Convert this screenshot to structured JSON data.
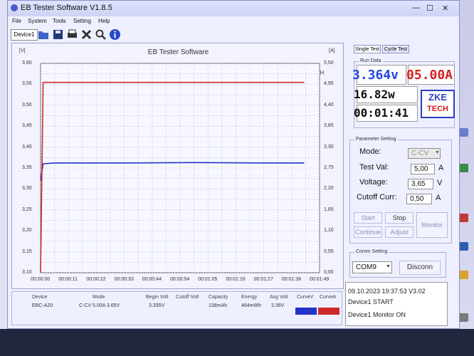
{
  "window": {
    "title": "EB Tester Software V1.8.5"
  },
  "menu": [
    "File",
    "System",
    "Tools",
    "Setting",
    "Help"
  ],
  "toolbar": {
    "device_tab": "Device1",
    "icons": [
      "folder-open-icon",
      "save-icon",
      "print-icon",
      "tools-icon",
      "magnifier-icon",
      "info-icon"
    ]
  },
  "chart": {
    "title": "EB Tester Software",
    "watermark": "ZKETECH",
    "left_unit": "[V]",
    "right_unit": "[A]",
    "y_ticks_left": [
      "3,60",
      "3,55",
      "3,50",
      "3,45",
      "3,40",
      "3,35",
      "3,30",
      "3,25",
      "3,20",
      "3,15",
      "3,10"
    ],
    "y_ticks_right": [
      "5,50",
      "4,95",
      "4,40",
      "3,85",
      "3,30",
      "2,75",
      "2,20",
      "1,65",
      "1,10",
      "0,55",
      "0,00"
    ],
    "x_ticks": [
      "00:00:00",
      "00:00:11",
      "00:00:22",
      "00:00:33",
      "00:00:44",
      "00:00:54",
      "00:01:05",
      "00:01:16",
      "00:01:27",
      "00:01:38",
      "00:01:49"
    ],
    "colors": {
      "voltage": "#2432c8",
      "current": "#cc2a2a"
    }
  },
  "chart_data": {
    "type": "line",
    "title": "EB Tester Software",
    "x": [
      "00:00:00",
      "00:00:01",
      "00:00:05",
      "00:00:30",
      "00:01:00",
      "00:01:30",
      "00:01:43"
    ],
    "xlim": [
      "00:00:00",
      "00:01:49"
    ],
    "series": [
      {
        "name": "CurveV",
        "axis": "left",
        "values": [
          3.32,
          3.36,
          3.362,
          3.362,
          3.363,
          3.362,
          3.362
        ]
      },
      {
        "name": "CurveA",
        "axis": "right",
        "values": [
          0.0,
          5.0,
          5.0,
          5.0,
          5.0,
          5.0,
          5.0
        ]
      }
    ],
    "ylim_left": [
      3.1,
      3.6
    ],
    "ylim_right": [
      0.0,
      5.5
    ],
    "grid": true
  },
  "summary": {
    "headers": [
      "Device",
      "Mode",
      "Begin Volt",
      "Cutoff Volt",
      "Capacity",
      "Energy",
      "Avg Volt",
      "CurveV",
      "CurveA"
    ],
    "values": [
      "EBC-A20",
      "C-CV  5.00A  3.65V",
      "3.335V",
      "",
      "138mAh",
      "464mWh",
      "3.36V"
    ]
  },
  "tabs": [
    "Single Test",
    "Cycle Test"
  ],
  "run_data": {
    "group_label": "Run Data",
    "voltage": "3.364v",
    "current": "05.00A",
    "power": "16.82w",
    "time": "00:01:41",
    "logo_top": "ZKE",
    "logo_bottom": "TECH"
  },
  "params": {
    "group_label": "Parameter Setting",
    "mode_label": "Mode:",
    "mode_value": "C-CV",
    "test_val_label": "Test Val:",
    "test_val": "5,00",
    "test_val_unit": "A",
    "voltage_label": "Voltage:",
    "voltage": "3,65",
    "voltage_unit": "V",
    "cutoff_label": "Cutoff Curr:",
    "cutoff": "0,50",
    "cutoff_unit": "A"
  },
  "buttons": {
    "start": "Start",
    "stop": "Stop",
    "continue": "Continue",
    "adjust": "Adjust",
    "monitor": "Monitor"
  },
  "comm": {
    "group_label": "Comm Setting",
    "port": "COM9",
    "disconnect": "Disconn"
  },
  "status": {
    "line1": "09.10.2023 19:37:53  V3.02",
    "line2": "Device1  START",
    "line3": "Device1   Monitor ON"
  }
}
